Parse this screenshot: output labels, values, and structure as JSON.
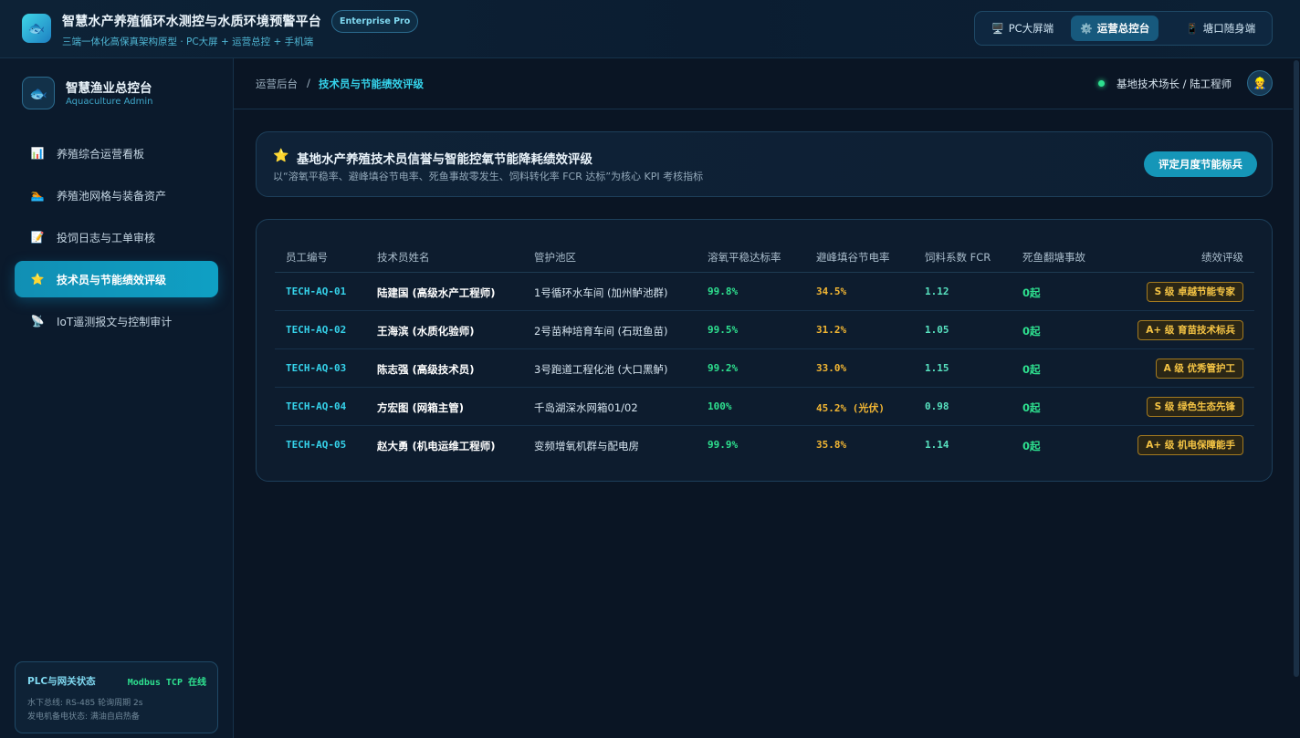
{
  "header": {
    "title": "智慧水产养殖循环水测控与水质环境预警平台",
    "subtitle": "三端一体化高保真架构原型 · PC大屏 + 运营总控 + 手机端",
    "edition": "Enterprise Pro",
    "modes": [
      {
        "icon": "🖥️",
        "label": "PC大屏端",
        "active": false
      },
      {
        "icon": "⚙️",
        "label": "运营总控台",
        "active": true
      },
      {
        "icon": "📱",
        "label": "塘口随身端",
        "active": false
      }
    ]
  },
  "sidebar": {
    "brand_title": "智慧渔业总控台",
    "brand_sub": "Aquaculture Admin",
    "items": [
      {
        "icon": "📊",
        "label": "养殖综合运营看板",
        "active": false
      },
      {
        "icon": "🏊",
        "label": "养殖池网格与装备资产",
        "active": false
      },
      {
        "icon": "📝",
        "label": "投饲日志与工单审核",
        "active": false
      },
      {
        "icon": "⭐",
        "label": "技术员与节能绩效评级",
        "active": true
      },
      {
        "icon": "📡",
        "label": "IoT遥测报文与控制审计",
        "active": false
      }
    ],
    "plc": {
      "title": "PLC与网关状态",
      "status": "Modbus TCP 在线",
      "line1": "水下总线: RS-485 轮询周期 2s",
      "line2": "发电机备电状态: 满油自启热备"
    }
  },
  "breadcrumb": {
    "root": "运营后台",
    "sep": "/",
    "current": "技术员与节能绩效评级",
    "user": "基地技术场长 / 陆工程师",
    "avatar": "👷"
  },
  "banner": {
    "icon": "⭐",
    "title": "基地水产养殖技术员信誉与智能控氧节能降耗绩效评级",
    "desc": "以“溶氧平稳率、避峰填谷节电率、死鱼事故零发生、饲料转化率 FCR 达标”为核心 KPI 考核指标",
    "button": "评定月度节能标兵"
  },
  "table": {
    "columns": [
      "员工编号",
      "技术员姓名",
      "管护池区",
      "溶氧平稳达标率",
      "避峰填谷节电率",
      "饲料系数 FCR",
      "死鱼翻塘事故",
      "绩效评级"
    ],
    "rows": [
      {
        "id": "TECH-AQ-01",
        "name": "陆建国 (高级水产工程师)",
        "pond": "1号循环水车间 (加州鲈池群)",
        "do_rate": "99.8%",
        "saving": "34.5%",
        "fcr": "1.12",
        "accidents": "0起",
        "grade": "S 级 卓越节能专家"
      },
      {
        "id": "TECH-AQ-02",
        "name": "王海滨 (水质化验师)",
        "pond": "2号苗种培育车间 (石斑鱼苗)",
        "do_rate": "99.5%",
        "saving": "31.2%",
        "fcr": "1.05",
        "accidents": "0起",
        "grade": "A+ 级 育苗技术标兵"
      },
      {
        "id": "TECH-AQ-03",
        "name": "陈志强 (高级技术员)",
        "pond": "3号跑道工程化池 (大口黑鲈)",
        "do_rate": "99.2%",
        "saving": "33.0%",
        "fcr": "1.15",
        "accidents": "0起",
        "grade": "A 级 优秀管护工"
      },
      {
        "id": "TECH-AQ-04",
        "name": "方宏图 (网箱主管)",
        "pond": "千岛湖深水网箱01/02",
        "do_rate": "100%",
        "saving": "45.2% (光伏)",
        "fcr": "0.98",
        "accidents": "0起",
        "grade": "S 级 绿色生态先锋"
      },
      {
        "id": "TECH-AQ-05",
        "name": "赵大勇 (机电运维工程师)",
        "pond": "变频增氧机群与配电房",
        "do_rate": "99.9%",
        "saving": "35.8%",
        "fcr": "1.14",
        "accidents": "0起",
        "grade": "A+ 级 机电保障能手"
      }
    ]
  }
}
